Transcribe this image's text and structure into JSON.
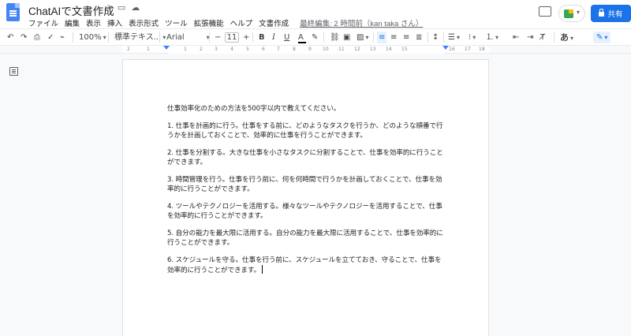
{
  "header": {
    "title": "ChatAIで文書作成",
    "title_icons": [
      "star-icon",
      "move-folder-icon",
      "cloud-status-icon"
    ],
    "menu": [
      "ファイル",
      "編集",
      "表示",
      "挿入",
      "表示形式",
      "ツール",
      "拡張機能",
      "ヘルプ",
      "文書作成"
    ],
    "last_edit": "最終編集: 2 時間前（kan taka さん）",
    "share_label": "共有"
  },
  "toolbar": {
    "zoom": "100%",
    "style": "標準テキス...",
    "font": "Arial",
    "font_size": "11",
    "minus": "−",
    "plus": "+",
    "bold": "B",
    "italic": "I",
    "underline": "U",
    "text_color": "A",
    "input_mode": "あ"
  },
  "ruler": {
    "marks": [
      "2",
      "1",
      "1",
      "2",
      "3",
      "4",
      "5",
      "6",
      "7",
      "8",
      "9",
      "10",
      "11",
      "12",
      "13",
      "14",
      "15",
      "16",
      "17",
      "18"
    ]
  },
  "document": {
    "paragraphs": [
      "仕事効率化のための方法を500字以内で教えてください。",
      "1. 仕事を計画的に行う。仕事をする前に、どのようなタスクを行うか、どのような順番で行うかを計画しておくことで、効率的に仕事を行うことができます。",
      "2. 仕事を分割する。大きな仕事を小さなタスクに分割することで、仕事を効率的に行うことができます。",
      "3. 時間管理を行う。仕事を行う前に、何を何時間で行うかを計画しておくことで、仕事を効率的に行うことができます。",
      "4. ツールやテクノロジーを活用する。様々なツールやテクノロジーを活用することで、仕事を効率的に行うことができます。",
      "5. 自分の能力を最大限に活用する。自分の能力を最大限に活用することで、仕事を効率的に行うことができます。",
      "6. スケジュールを守る。仕事を行う前に、スケジュールを立てておき、守ることで、仕事を効率的に行うことができます。"
    ]
  },
  "colors": {
    "accent": "#1a73e8",
    "doc_icon": "#4285f4"
  }
}
